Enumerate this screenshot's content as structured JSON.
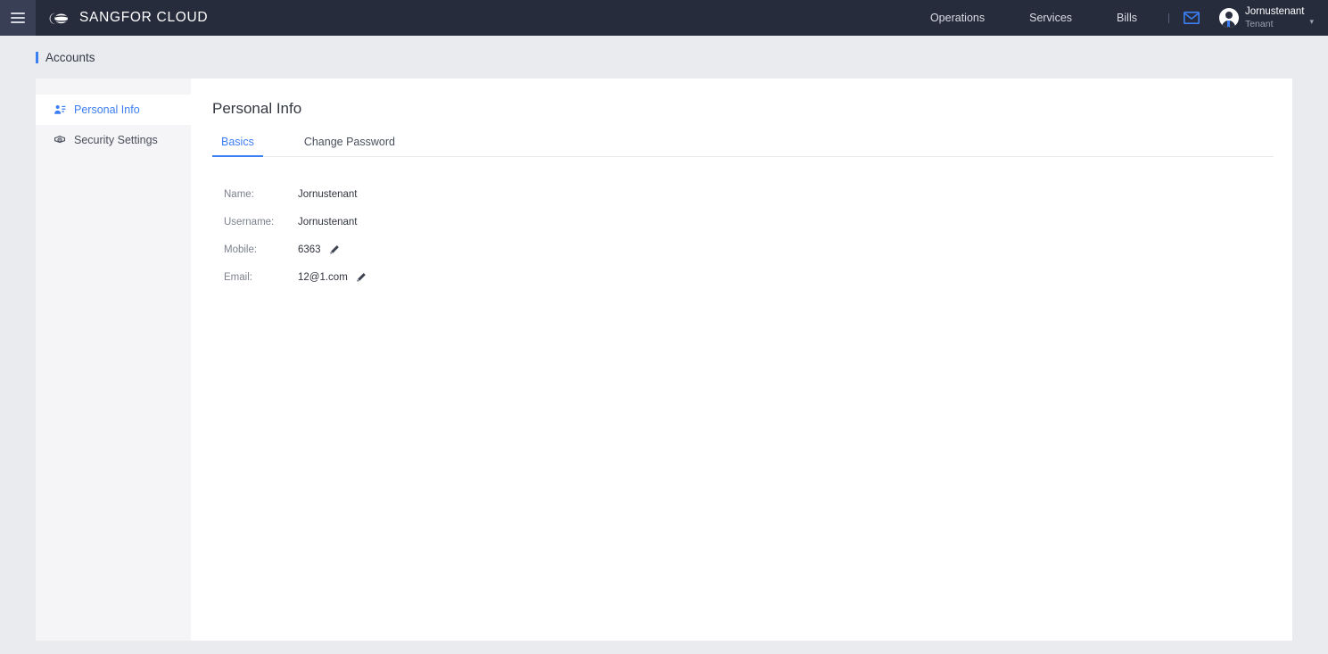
{
  "header": {
    "menu_icon": "hamburger-icon",
    "brand": "SANGFOR CLOUD",
    "brand_logo_icon": "cloud-logo-icon",
    "nav": [
      {
        "label": "Operations"
      },
      {
        "label": "Services"
      },
      {
        "label": "Bills"
      }
    ],
    "mail_icon": "envelope-icon",
    "user": {
      "avatar_icon": "user-avatar-icon",
      "name": "Jornustenant",
      "role": "Tenant",
      "caret_icon": "chevron-down-icon"
    }
  },
  "breadcrumb": {
    "text": "Accounts"
  },
  "sidebar": {
    "items": [
      {
        "label": "Personal Info",
        "icon": "user-card-icon",
        "active": true
      },
      {
        "label": "Security Settings",
        "icon": "shield-gear-icon",
        "active": false
      }
    ]
  },
  "main": {
    "title": "Personal Info",
    "tabs": [
      {
        "label": "Basics",
        "active": true
      },
      {
        "label": "Change Password",
        "active": false
      }
    ],
    "fields": [
      {
        "label": "Name:",
        "value": "Jornustenant",
        "editable": false
      },
      {
        "label": "Username:",
        "value": "Jornustenant",
        "editable": false
      },
      {
        "label": "Mobile:",
        "value": "6363",
        "editable": true
      },
      {
        "label": "Email:",
        "value": "12@1.com",
        "editable": true
      }
    ]
  },
  "colors": {
    "header_bg": "#272c3c",
    "menu_bg": "#393f54",
    "page_bg": "#eaebef",
    "accent": "#3c7ef3",
    "sidebar_bg": "#f5f5f7",
    "content_bg": "#ffffff"
  }
}
